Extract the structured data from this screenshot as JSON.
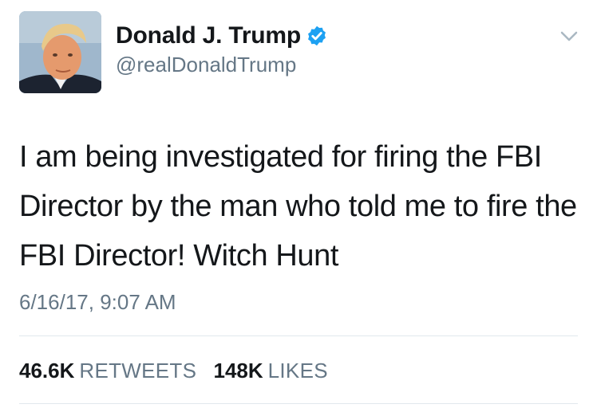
{
  "author": {
    "display_name": "Donald J. Trump",
    "handle": "@realDonaldTrump",
    "verified": true
  },
  "tweet": {
    "text": "I am being investigated for firing the FBI Director by the man who told me to fire the FBI Director! Witch Hunt",
    "timestamp": "6/16/17, 9:07 AM"
  },
  "stats": {
    "retweets_count": "46.6K",
    "retweets_label": "RETWEETS",
    "likes_count": "148K",
    "likes_label": "LIKES"
  },
  "icons": {
    "verified": "verified-badge-icon",
    "menu": "chevron-down-icon"
  },
  "colors": {
    "verified_blue": "#1da1f2",
    "secondary_text": "#657786",
    "primary_text": "#14171a",
    "divider": "#e1e8ed"
  }
}
